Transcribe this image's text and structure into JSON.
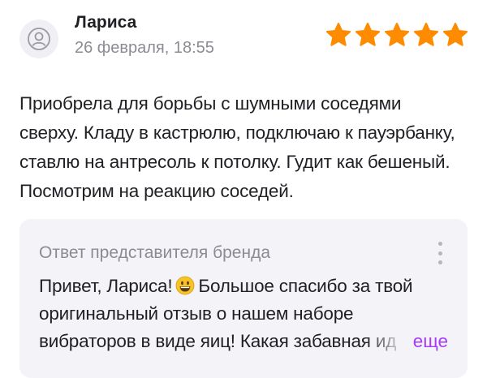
{
  "review": {
    "author_name": "Лариса",
    "date": "26 февраля, 18:55",
    "rating": 5,
    "rating_max": 5,
    "star_color": "#ff8c00",
    "text": "Приобрела для борьбы с шумными соседями сверху. Кладу в кастрюлю, подключаю к пауэрбанку, ставлю на антресоль к потолку. Гудит как бешеный. Посмотрим на реакцию соседей."
  },
  "brand_reply": {
    "title": "Ответ представителя бренда",
    "text_before_emoji": "Привет, Лариса!",
    "emoji": "grinning-face-emoji",
    "text_after_emoji": "Большое спасибо за твой оригинальный отзыв о нашем наборе вибраторов в виде яиц! Какая забавная ид",
    "more_label": "еще",
    "more_color": "#a73afd",
    "menu_icon": "kebab-menu-icon"
  }
}
